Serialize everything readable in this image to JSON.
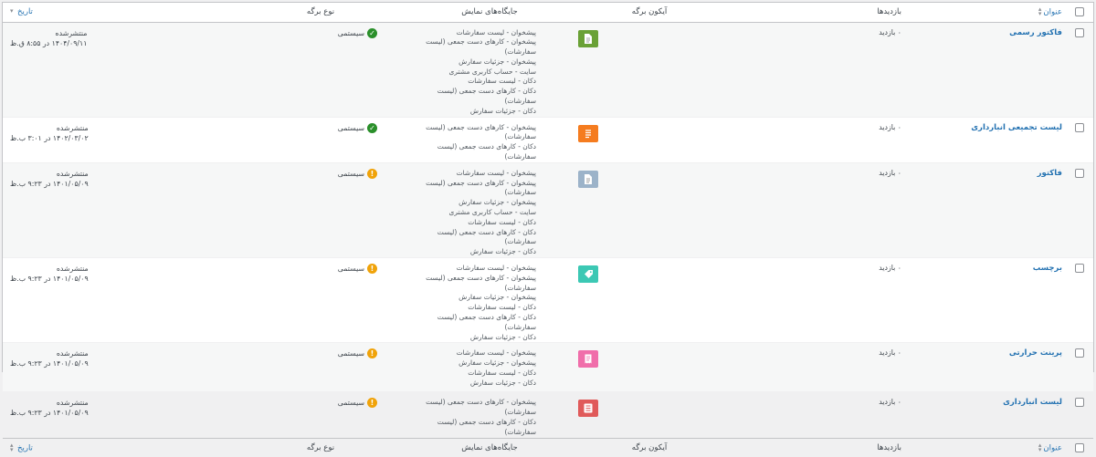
{
  "columns": {
    "title": "عنوان",
    "views": "بازدیدها",
    "icon": "آیکون برگه",
    "locations": "جایگاه‌های نمایش",
    "type": "نوع برگه",
    "date": "تاریخ"
  },
  "rows": [
    {
      "title": "فاکتور رسمی",
      "views": "۰ بازدید",
      "icon": "document-icon",
      "icon_color": "#6aa136",
      "locations": [
        "پیشخوان - لیست سفارشات",
        "پیشخوان - کارهای دست جمعی (لیست سفارشات)",
        "پیشخوان - جزئیات سفارش",
        "سایت - حساب کاربری مشتری",
        "دکان - لیست سفارشات",
        "دکان - کارهای دست جمعی (لیست سفارشات)",
        "دکان - جزئیات سفارش"
      ],
      "type": "سیستمی",
      "type_status": "ok",
      "status": "منتشرشده",
      "date": "۱۴۰۴/۰۹/۱۱ در ۸:۵۵ ق.ظ"
    },
    {
      "title": "لیست تجمیعی انبارداری",
      "views": "۰ بازدید",
      "icon": "list-icon",
      "icon_color": "#f57c1f",
      "locations": [
        "پیشخوان - کارهای دست جمعی (لیست سفارشات)",
        "دکان - کارهای دست جمعی (لیست سفارشات)"
      ],
      "type": "سیستمی",
      "type_status": "ok",
      "status": "منتشرشده",
      "date": "۱۴۰۲/۰۳/۰۲ در ۳:۰۱ ب.ظ"
    },
    {
      "title": "فاکتور",
      "views": "۰ بازدید",
      "icon": "document-icon",
      "icon_color": "#9cb3c9",
      "locations": [
        "پیشخوان - لیست سفارشات",
        "پیشخوان - کارهای دست جمعی (لیست سفارشات)",
        "پیشخوان - جزئیات سفارش",
        "سایت - حساب کاربری مشتری",
        "دکان - لیست سفارشات",
        "دکان - کارهای دست جمعی (لیست سفارشات)",
        "دکان - جزئیات سفارش"
      ],
      "type": "سیستمی",
      "type_status": "warn",
      "status": "منتشرشده",
      "date": "۱۴۰۱/۰۵/۰۹ در ۹:۲۳ ب.ظ"
    },
    {
      "title": "برچسب",
      "views": "۰ بازدید",
      "icon": "tag-icon",
      "icon_color": "#3cc8b4",
      "locations": [
        "پیشخوان - لیست سفارشات",
        "پیشخوان - کارهای دست جمعی (لیست سفارشات)",
        "پیشخوان - جزئیات سفارش",
        "دکان - لیست سفارشات",
        "دکان - کارهای دست جمعی (لیست سفارشات)",
        "دکان - جزئیات سفارش"
      ],
      "type": "سیستمی",
      "type_status": "warn",
      "status": "منتشرشده",
      "date": "۱۴۰۱/۰۵/۰۹ در ۹:۲۳ ب.ظ"
    },
    {
      "title": "پرینت حرارتی",
      "views": "۰ بازدید",
      "icon": "receipt-icon",
      "icon_color": "#f06eaa",
      "locations": [
        "پیشخوان - لیست سفارشات",
        "پیشخوان - جزئیات سفارش",
        "دکان - لیست سفارشات",
        "دکان - جزئیات سفارش"
      ],
      "type": "سیستمی",
      "type_status": "warn",
      "status": "منتشرشده",
      "date": "۱۴۰۱/۰۵/۰۹ در ۹:۲۳ ب.ظ"
    },
    {
      "title": "لیست انبارداری",
      "views": "۰ بازدید",
      "icon": "list-alt-icon",
      "icon_color": "#e05a5a",
      "locations": [
        "پیشخوان - کارهای دست جمعی (لیست سفارشات)",
        "دکان - کارهای دست جمعی (لیست سفارشات)"
      ],
      "type": "سیستمی",
      "type_status": "warn",
      "status": "منتشرشده",
      "date": "۱۴۰۱/۰۵/۰۹ در ۹:۲۳ ب.ظ"
    }
  ]
}
